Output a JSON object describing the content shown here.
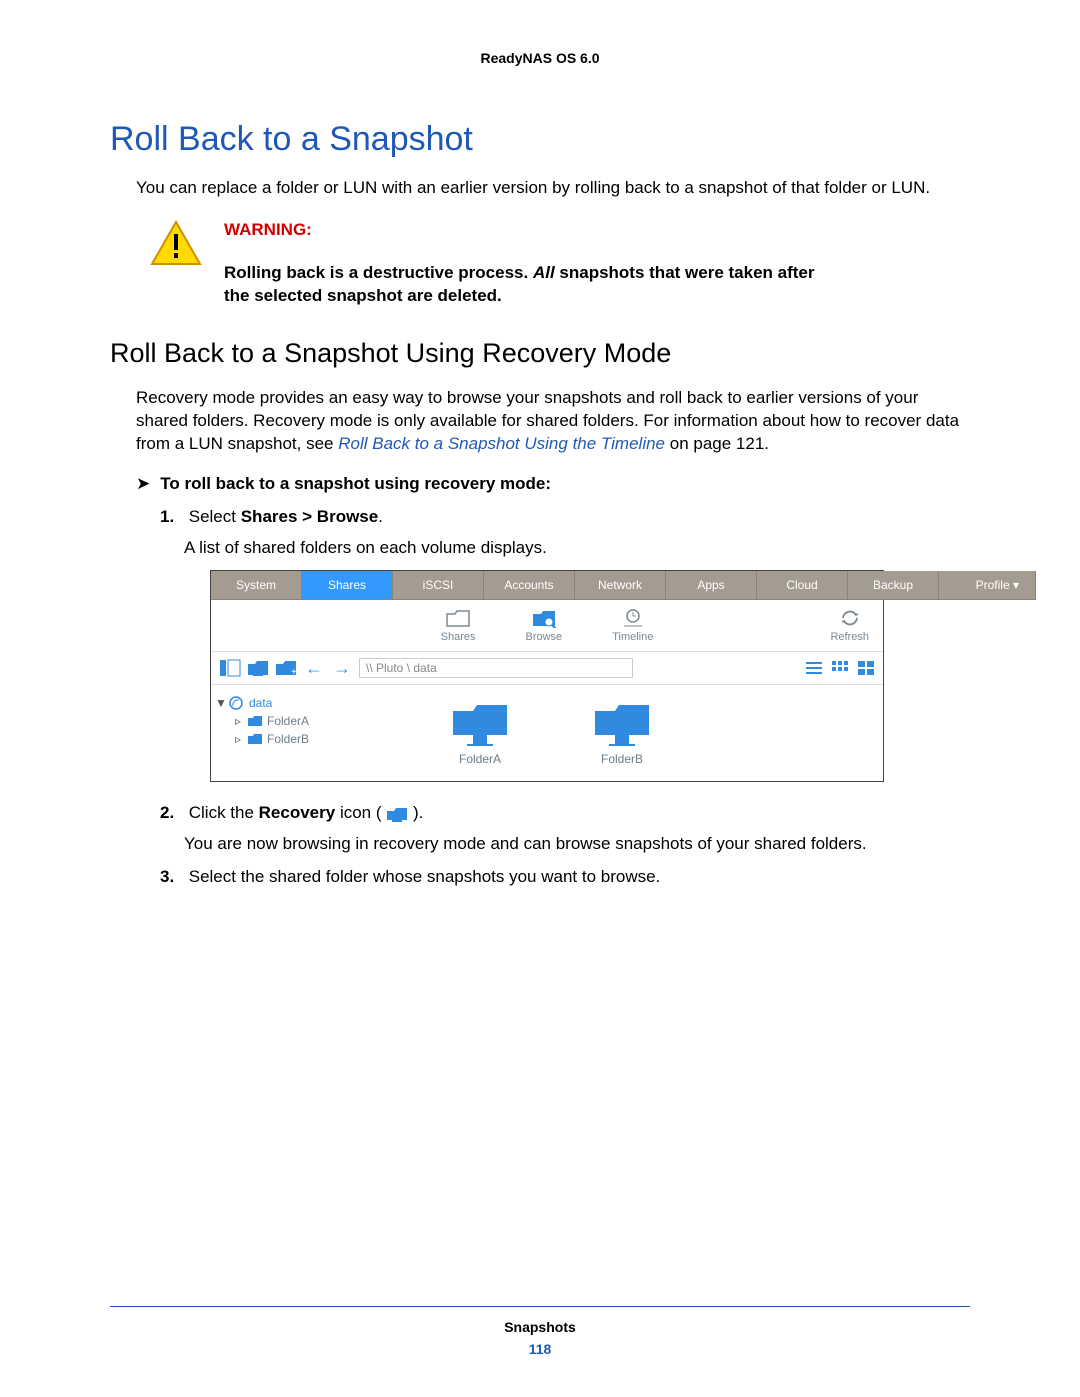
{
  "header": "ReadyNAS OS 6.0",
  "h1": "Roll Back to a Snapshot",
  "intro": "You can replace a folder or LUN with an earlier version by rolling back to a snapshot of that folder or LUN.",
  "warning": {
    "label": "WARNING:",
    "body_prefix": "Rolling back is a destructive process. ",
    "body_italic": "All",
    "body_suffix": " snapshots that were taken after the selected snapshot are deleted."
  },
  "h2": "Roll Back to a Snapshot Using Recovery Mode",
  "p2_a": "Recovery mode provides an easy way to browse your snapshots and roll back to earlier versions of your shared folders. Recovery mode is only available for shared folders. For information about how to recover data from a LUN snapshot, see ",
  "p2_link": "Roll Back to a Snapshot Using the Timeline",
  "p2_b": " on page 121.",
  "proc_head": "To roll back to a snapshot using recovery mode:",
  "steps": {
    "s1_a": "Select ",
    "s1_b": "Shares > Browse",
    "s1_c": ".",
    "s1_sub": "A list of shared folders on each volume displays.",
    "s2_a": "Click the ",
    "s2_b": "Recovery",
    "s2_c": " icon (",
    "s2_d": ").",
    "s2_sub": "You are now browsing in recovery mode and can browse snapshots of your shared folders.",
    "s3": "Select the shared folder whose snapshots you want to browse."
  },
  "screenshot": {
    "tabs": [
      "System",
      "Shares",
      "iSCSI",
      "Accounts",
      "Network",
      "Apps",
      "Cloud",
      "Backup",
      "Profile ▾"
    ],
    "active_tab_index": 1,
    "toolbar": [
      "Shares",
      "Browse",
      "Timeline"
    ],
    "toolbar_refresh": "Refresh",
    "path": "\\\\ Pluto \\ data",
    "tree": {
      "root": "data",
      "children": [
        "FolderA",
        "FolderB"
      ]
    },
    "tiles": [
      "FolderA",
      "FolderB"
    ]
  },
  "footer": {
    "section": "Snapshots",
    "page": "118"
  }
}
